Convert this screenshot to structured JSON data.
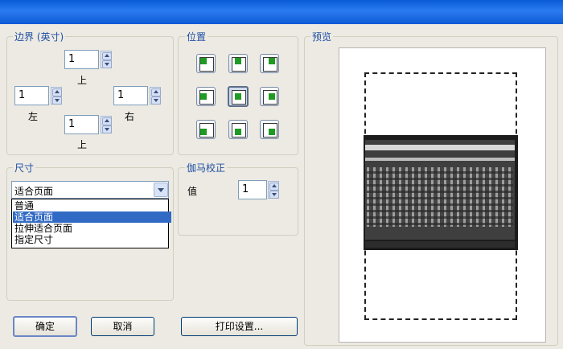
{
  "margins": {
    "title": "边界 (英寸)",
    "top_value": "1",
    "top_label": "上",
    "left_value": "1",
    "left_label": "左",
    "right_value": "1",
    "right_label": "右",
    "bottom_value": "1",
    "bottom_label": "上"
  },
  "position": {
    "title": "位置"
  },
  "preview": {
    "title": "预览"
  },
  "size": {
    "title": "尺寸",
    "selected": "适合页面",
    "options": [
      "普通",
      "适合页面",
      "拉伸适合页面",
      "指定尺寸"
    ]
  },
  "gamma": {
    "title": "伽马校正",
    "label": "值",
    "value": "1"
  },
  "buttons": {
    "ok": "确定",
    "cancel": "取消",
    "print_setup": "打印设置..."
  },
  "colors": {
    "titlebar": "#0a5bd8",
    "selection": "#316ac5",
    "position_marker": "#1f9a23"
  }
}
